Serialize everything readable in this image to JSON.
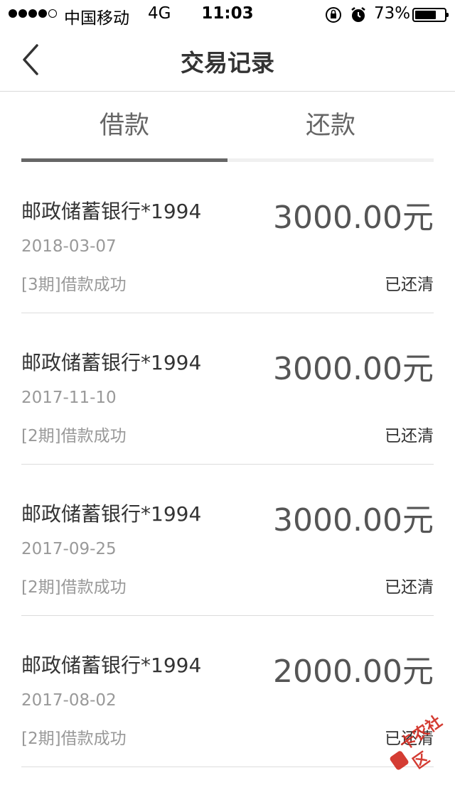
{
  "status_bar": {
    "carrier": "中国移动",
    "network": "4G",
    "time": "11:03",
    "battery_percent": "73%",
    "battery_level": 0.73,
    "signal_bars_filled": 4,
    "signal_bars_total": 5,
    "icons": [
      "orientation-lock-icon",
      "alarm-icon",
      "battery-icon"
    ]
  },
  "nav": {
    "title": "交易记录",
    "back_icon": "chevron-left-icon"
  },
  "tabs": [
    {
      "label": "借款",
      "active": true
    },
    {
      "label": "还款",
      "active": false
    }
  ],
  "records": [
    {
      "bank": "邮政储蓄银行*1994",
      "date": "2018-03-07",
      "desc": "[3期]借款成功",
      "amount": "3000.00元",
      "status": "已还清"
    },
    {
      "bank": "邮政储蓄银行*1994",
      "date": "2017-11-10",
      "desc": "[2期]借款成功",
      "amount": "3000.00元",
      "status": "已还清"
    },
    {
      "bank": "邮政储蓄银行*1994",
      "date": "2017-09-25",
      "desc": "[2期]借款成功",
      "amount": "3000.00元",
      "status": "已还清"
    },
    {
      "bank": "邮政储蓄银行*1994",
      "date": "2017-08-02",
      "desc": "[2期]借款成功",
      "amount": "2000.00元",
      "status": "已还清"
    }
  ],
  "watermark": {
    "text": "卡农社区",
    "color": "#d0281d"
  },
  "colors": {
    "tab_indicator": "#666666",
    "divider": "#dcdcdc",
    "secondary_text": "#999999"
  }
}
